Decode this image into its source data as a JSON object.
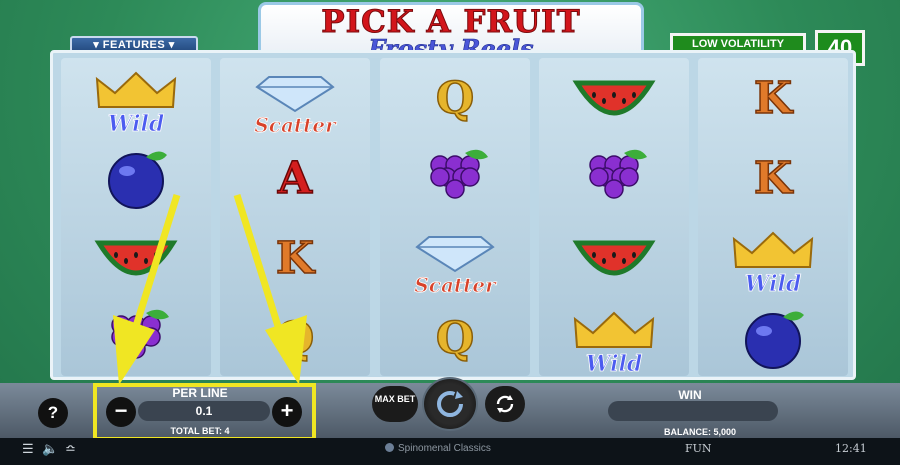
{
  "game": {
    "title": "PICK A FRUIT",
    "subtitle": "Frosty Reels",
    "features_label": "▾ FEATURES ▾",
    "volatility_label": "LOW VOLATILITY",
    "lines": "40"
  },
  "reels": [
    [
      "Wild",
      "plum",
      "watermelon",
      "grapes"
    ],
    [
      "Scatter",
      "A",
      "K",
      "Q"
    ],
    [
      "Q",
      "grapes",
      "Scatter",
      "Q"
    ],
    [
      "watermelon",
      "grapes",
      "watermelon",
      "Wild"
    ],
    [
      "K",
      "K",
      "Wild",
      "plum"
    ]
  ],
  "controls": {
    "help": "?",
    "per_line_label": "PER LINE",
    "bet_value": "0.1",
    "minus": "−",
    "plus": "+",
    "total_bet": "TOTAL BET: 4",
    "max_bet": "MAX BET",
    "win_label": "WIN",
    "balance": "BALANCE: 5,000"
  },
  "status_bar": {
    "provider": "Spinomenal Classics",
    "mode": "FUN",
    "time": "12:41"
  },
  "colors": {
    "highlight": "#f0e623",
    "background": "#2d8a58",
    "title_red": "#d2151b"
  }
}
